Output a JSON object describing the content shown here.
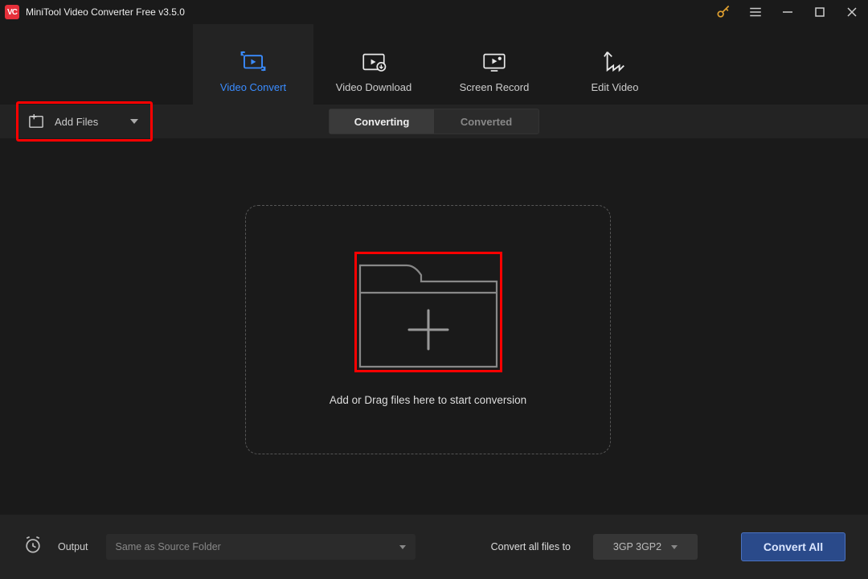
{
  "app": {
    "title": "MiniTool Video Converter Free v3.5.0",
    "logo_text": "VC"
  },
  "main_tabs": {
    "video_convert": "Video Convert",
    "video_download": "Video Download",
    "screen_record": "Screen Record",
    "edit_video": "Edit Video"
  },
  "toolbar": {
    "add_files": "Add Files"
  },
  "sub_tabs": {
    "converting": "Converting",
    "converted": "Converted"
  },
  "dropzone": {
    "text": "Add or Drag files here to start conversion"
  },
  "bottom": {
    "output_label": "Output",
    "output_value": "Same as Source Folder",
    "convert_all_label": "Convert all files to",
    "format_value": "3GP 3GP2",
    "convert_all_btn": "Convert All"
  }
}
